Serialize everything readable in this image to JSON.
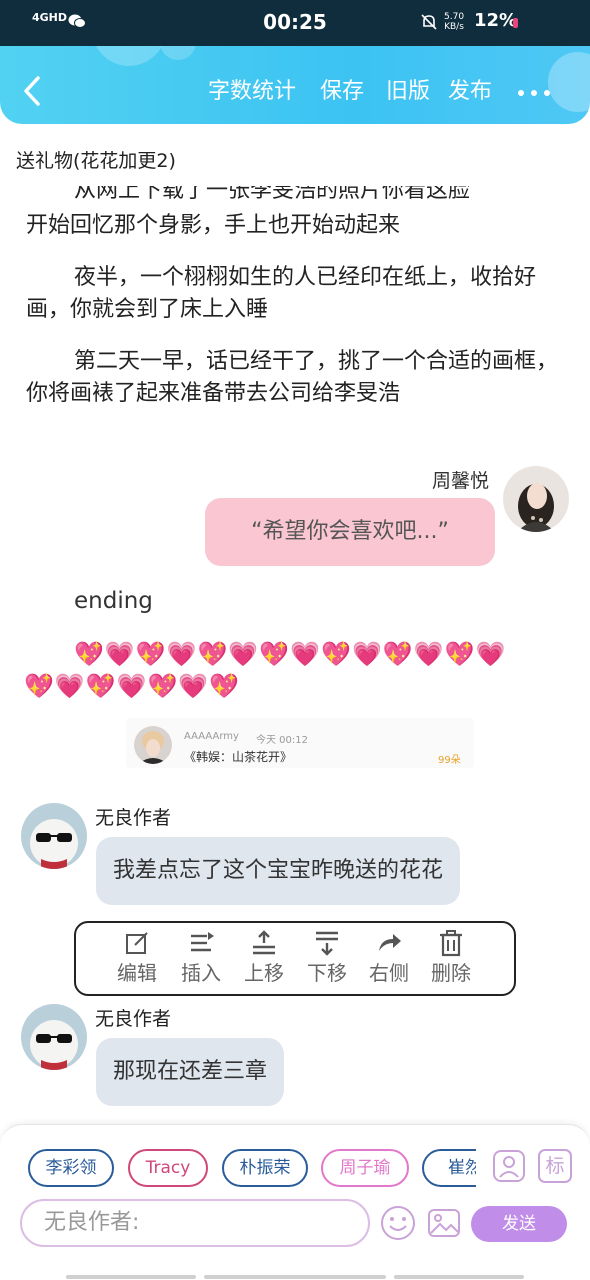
{
  "status_bar": {
    "network": "4GHD",
    "time": "00:25",
    "speed_value": "5.70",
    "speed_unit": "KB/s",
    "battery": "12%"
  },
  "toolbar": {
    "word_count": "字数统计",
    "save": "保存",
    "old_version": "旧版",
    "publish": "发布"
  },
  "chapter_title": "送礼物(花花加更2)",
  "story": {
    "cut_line": "从网上下载了一张李旻浩的照片你看这脸",
    "para0_tail": "开始回忆那个身影，手上也开始动起来",
    "para1": "夜半，一个栩栩如生的人已经印在纸上，收拾好画，你就会到了床上入睡",
    "para2": "第二天一早，话已经干了，挑了一个合适的画框，你将画裱了起来准备带去公司给李旻浩"
  },
  "character_message": {
    "name": "周馨悦",
    "text": "“希望你会喜欢吧...”"
  },
  "ending_text": "ending",
  "hearts_row1": "💖💗💖💗💖💗💖💗💖💗💖💗💖💗",
  "hearts_row2": "💖💗💖💗💖💗💖",
  "gift": {
    "user": "AAAAArmy",
    "time": "今天 00:12",
    "title": "《韩娱：山茶花开》",
    "count": "99朵"
  },
  "author_messages": [
    {
      "name": "无良作者",
      "text": "我差点忘了这个宝宝昨晚送的花花"
    },
    {
      "name": "无良作者",
      "text": "那现在还差三章"
    }
  ],
  "context_menu": {
    "edit": "编辑",
    "insert": "插入",
    "move_up": "上移",
    "move_down": "下移",
    "right_side": "右侧",
    "delete": "删除"
  },
  "characters": [
    {
      "name": "李彩领",
      "color": "#2a5c9a"
    },
    {
      "name": "Tracy",
      "color": "#d0477a"
    },
    {
      "name": "朴振荣",
      "color": "#2a5c9a"
    },
    {
      "name": "周子瑜",
      "color": "#e278c9"
    },
    {
      "name": "崔然",
      "color": "#2a5c9a"
    }
  ],
  "mark_label": "标",
  "input_placeholder": "无良作者:",
  "send_label": "发送",
  "colors": {
    "toolbar_start": "#52d2f2",
    "pink_bubble": "#f9c6d2",
    "gray_bubble": "#dfe6ee",
    "send_button": "#c08de8"
  }
}
